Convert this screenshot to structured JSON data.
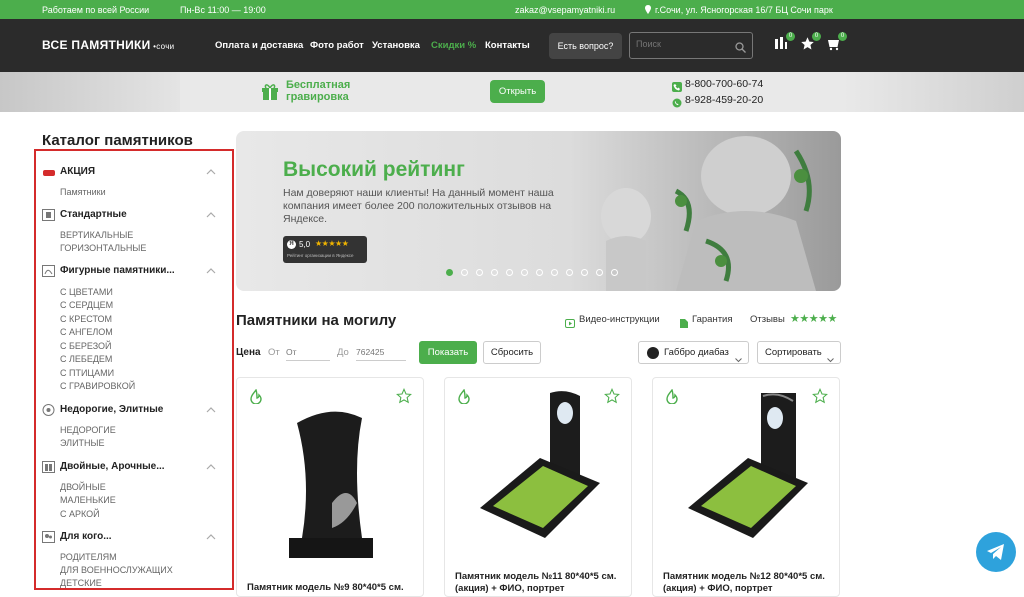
{
  "topbar": {
    "region": "Работаем по всей России",
    "hours": "Пн-Вс 11:00 — 19:00",
    "email": "zakaz@vsepamyatniki.ru",
    "address": "г.Сочи, ул. Ясногорская 16/7 БЦ Сочи парк"
  },
  "header": {
    "logo": "ВСЕ ПАМЯТНИКИ",
    "logo_city": "сочи",
    "nav": [
      "Оплата и доставка",
      "Фото работ",
      "Установка",
      "Скидки %",
      "Контакты"
    ],
    "question_label": "Есть вопрос?",
    "search_placeholder": "Поиск",
    "badges": [
      "0",
      "0",
      "0"
    ]
  },
  "promo": {
    "line1": "Бесплатная",
    "line2": "гравировка",
    "open_label": "Открыть",
    "phone1": "8-800-700-60-74",
    "phone2": "8-928-459-20-20"
  },
  "catalog": {
    "title": "Каталог памятников",
    "sections": [
      {
        "title": "АКЦИЯ",
        "items": [
          "Памятники"
        ]
      },
      {
        "title": "Стандартные",
        "items": [
          "ВЕРТИКАЛЬНЫЕ",
          "ГОРИЗОНТАЛЬНЫЕ"
        ]
      },
      {
        "title": "Фигурные памятники...",
        "items": [
          "С ЦВЕТАМИ",
          "С СЕРДЦЕМ",
          "С КРЕСТОМ",
          "С АНГЕЛОМ",
          "С БЕРЕЗОЙ",
          "С ЛЕБЕДЕМ",
          "С ПТИЦАМИ",
          "С ГРАВИРОВКОЙ"
        ]
      },
      {
        "title": "Недорогие, Элитные",
        "items": [
          "НЕДОРОГИЕ",
          "ЭЛИТНЫЕ"
        ]
      },
      {
        "title": "Двойные, Арочные...",
        "items": [
          "ДВОЙНЫЕ",
          "МАЛЕНЬКИЕ",
          "С АРКОЙ"
        ]
      },
      {
        "title": "Для кого...",
        "items": [
          "РОДИТЕЛЯМ",
          "ДЛЯ ВОЕННОСЛУЖАЩИХ",
          "ДЕТСКИЕ"
        ]
      }
    ]
  },
  "banner": {
    "title": "Высокий рейтинг",
    "text": "Нам доверяют наши клиенты! На данный момент наша компания имеет более 200 положительных отзывов на Яндексе.",
    "rating": "5,0",
    "rating_caption": "Рейтинг организации в Яндексе",
    "slides": 12,
    "active_slide": 0
  },
  "products_section": {
    "title": "Памятники на могилу",
    "links": [
      "Видео-инструкции",
      "Гарантия",
      "Отзывы"
    ],
    "price_label": "Цена",
    "from_label": "От",
    "from_placeholder": "От",
    "to_label": "До",
    "to_placeholder": "762425",
    "show_label": "Показать",
    "reset_label": "Сбросить",
    "color_label": "Габбро диабаз",
    "sort_label": "Сортировать"
  },
  "products": [
    {
      "title": "Памятник модель №9 80*40*5 см."
    },
    {
      "title": "Памятник модель №11 80*40*5 см. (акция) + ФИО, портрет"
    },
    {
      "title": "Памятник модель №12 80*40*5 см. (акция) + ФИО, портрет"
    }
  ],
  "colors": {
    "accent": "#4cae4c",
    "dark": "#2b2b2b",
    "highlight": "#d42b2b",
    "telegram": "#2ea2dc"
  }
}
